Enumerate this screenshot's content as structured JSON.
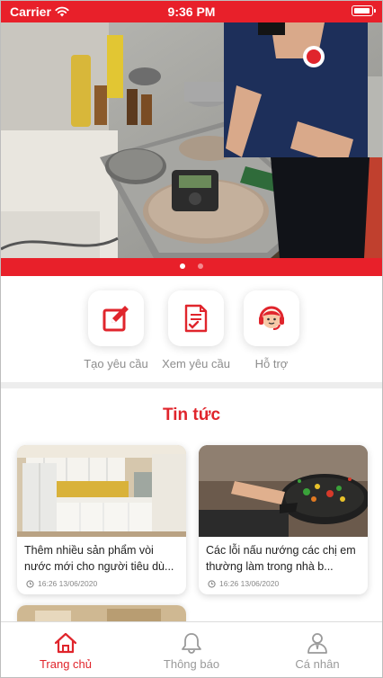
{
  "status_bar": {
    "carrier": "Carrier",
    "time": "9:36 PM",
    "bg_color": "#e8202a"
  },
  "banner": {
    "slide_count": 2,
    "active_slide": 1
  },
  "actions": [
    {
      "label": "Tạo yêu cầu",
      "icon": "edit-icon"
    },
    {
      "label": "Xem yêu cầu",
      "icon": "document-check-icon"
    },
    {
      "label": "Hỗ trợ",
      "icon": "support-agent-icon"
    }
  ],
  "news": {
    "title": "Tin tức",
    "items": [
      {
        "title": "Thêm nhiều sản phẩm vòi nước mới cho người tiêu dù...",
        "time": "16:26 13/06/2020"
      },
      {
        "title": "Các lỗi nấu nướng các chị em thường làm trong nhà b...",
        "time": "16:26 13/06/2020"
      }
    ]
  },
  "bottom_nav": [
    {
      "label": "Trang chủ",
      "icon": "home-icon",
      "active": true
    },
    {
      "label": "Thông báo",
      "icon": "bell-icon",
      "active": false
    },
    {
      "label": "Cá nhân",
      "icon": "person-icon",
      "active": false
    }
  ],
  "colors": {
    "accent": "#e0252c",
    "muted_text": "#8d8d8d"
  }
}
